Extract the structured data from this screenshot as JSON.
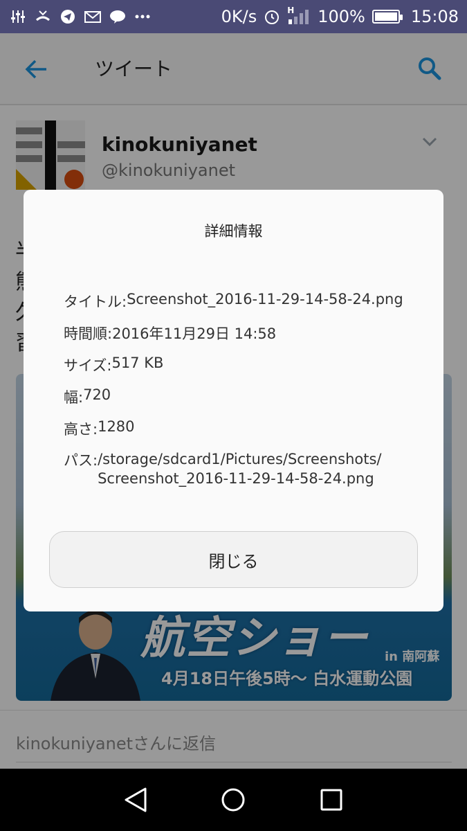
{
  "status_bar": {
    "net_speed": "0K/s",
    "signal_label": "H",
    "battery": "100%",
    "battery_level": 1.0,
    "time": "15:08"
  },
  "app_bar": {
    "title": "ツイート",
    "back_icon": "arrow-left-icon",
    "search_icon": "search-icon"
  },
  "tweet": {
    "user_name": "kinokuniyanet",
    "user_handle": "@kinokuniyanet",
    "visible_text_chars": [
      "半",
      "熊",
      "久",
      "習"
    ],
    "image": {
      "banner": "航空ショー",
      "place": "in 南阿蘇",
      "subline": "4月18日午後5時～ 白水運動公園"
    },
    "reply_placeholder": "kinokuniyanetさんに返信"
  },
  "dialog": {
    "title": "詳細情報",
    "rows": [
      {
        "label": "タイトル: ",
        "value": "Screenshot_2016-11-29-14-58-24.png"
      },
      {
        "label": "時間順: ",
        "value": "2016年11月29日 14:58"
      },
      {
        "label": "サイズ: ",
        "value": "517 KB"
      },
      {
        "label": "幅: ",
        "value": "720"
      },
      {
        "label": "高さ: ",
        "value": "1280"
      },
      {
        "label": "パス: ",
        "value_line1": "/storage/sdcard1/Pictures/Screenshots/",
        "value_line2": "Screenshot_2016-11-29-14-58-24.png"
      }
    ],
    "close_label": "閉じる"
  },
  "colors": {
    "status_bar": "#4a4a75",
    "accent": "#1b95e0",
    "scrim": "rgba(0,0,0,0.40)",
    "dialog_bg": "#fafafa",
    "nav_bar": "#000000"
  }
}
